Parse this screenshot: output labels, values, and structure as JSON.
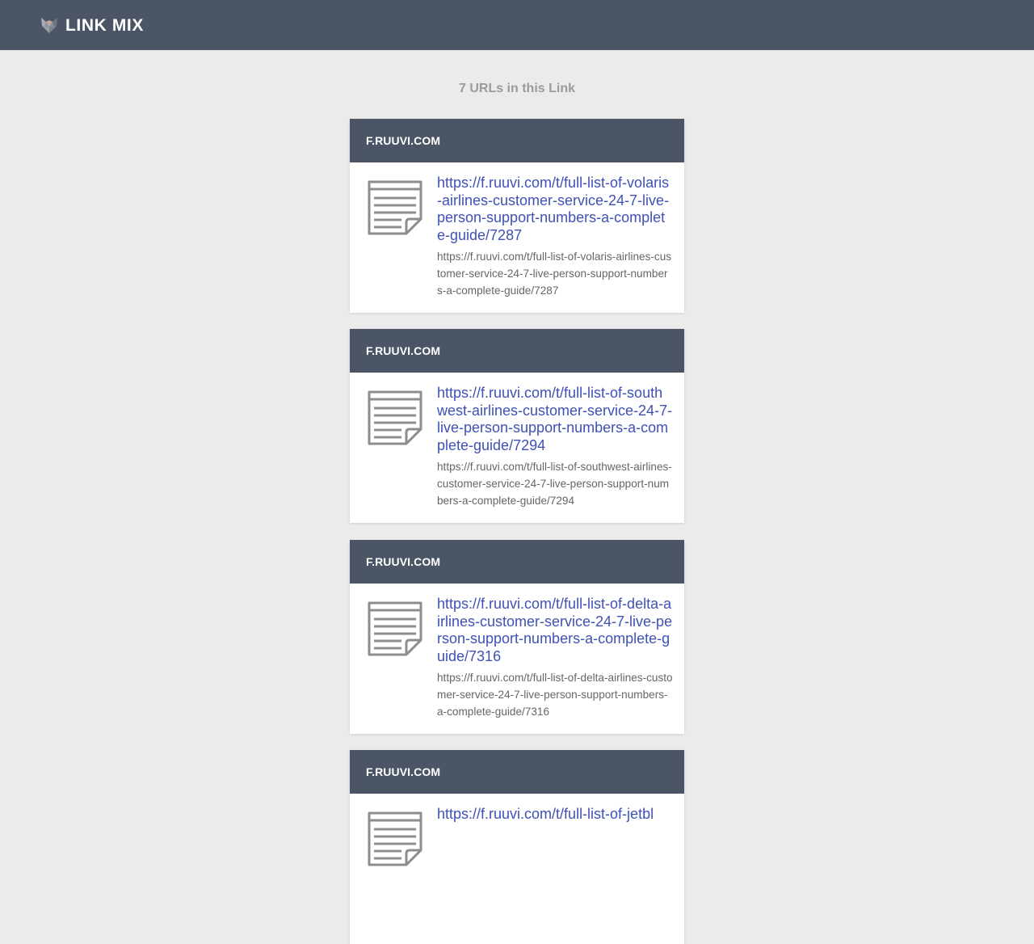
{
  "header": {
    "brand_name": "LINK MIX",
    "logo_icon": "fox-logo-icon",
    "background_color": "#4b5566"
  },
  "summary": {
    "count_text": "7 URLs in this Link"
  },
  "links": [
    {
      "domain": "F.RUUVI.COM",
      "title": "https://f.ruuvi.com/t/full-list-of-volaris-airlines-customer-service-24-7-live-person-support-numbers-a-complete-guide/7287",
      "url": "https://f.ruuvi.com/t/full-list-of-volaris-airlines-customer-service-24-7-live-person-support-numbers-a-complete-guide/7287",
      "icon": "document-icon"
    },
    {
      "domain": "F.RUUVI.COM",
      "title": "https://f.ruuvi.com/t/full-list-of-southwest-airlines-customer-service-24-7-live-person-support-numbers-a-complete-guide/7294",
      "url": "https://f.ruuvi.com/t/full-list-of-southwest-airlines-customer-service-24-7-live-person-support-numbers-a-complete-guide/7294",
      "icon": "document-icon"
    },
    {
      "domain": "F.RUUVI.COM",
      "title": "https://f.ruuvi.com/t/full-list-of-delta-airlines-customer-service-24-7-live-person-support-numbers-a-complete-guide/7316",
      "url": "https://f.ruuvi.com/t/full-list-of-delta-airlines-customer-service-24-7-live-person-support-numbers-a-complete-guide/7316",
      "icon": "document-icon"
    },
    {
      "domain": "F.RUUVI.COM",
      "title": "https://f.ruuvi.com/t/full-list-of-jetbl",
      "url": "",
      "icon": "document-icon"
    }
  ],
  "colors": {
    "header_bg": "#4b5566",
    "page_bg": "#ebebeb",
    "link": "#3f51b5",
    "url_text": "#666666",
    "count_text": "#9a9a9a"
  }
}
